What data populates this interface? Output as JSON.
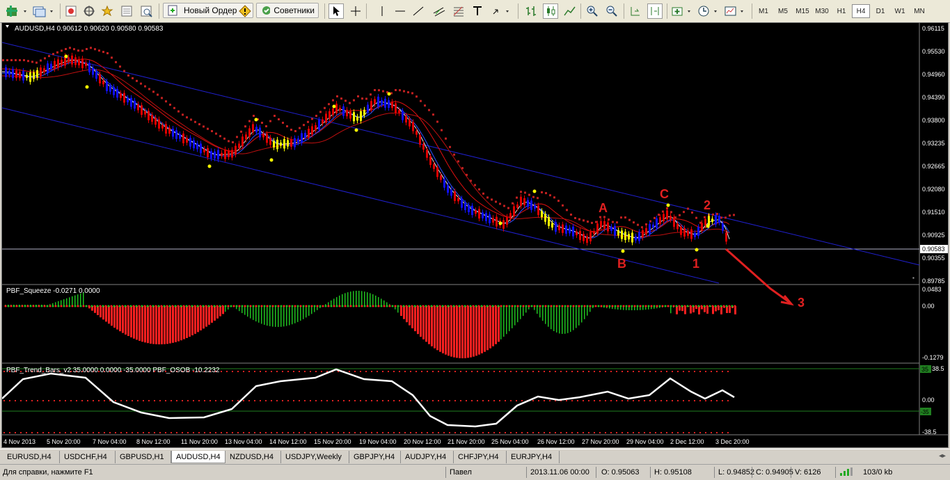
{
  "toolbar": {
    "new_order_label": "Новый Ордер",
    "advisors_label": "Советники",
    "timeframes": [
      "M1",
      "M5",
      "M15",
      "M30",
      "H1",
      "H4",
      "D1",
      "W1",
      "MN"
    ],
    "active_timeframe": "H4"
  },
  "chart": {
    "header": "AUDUSD,H4  0.90612 0.90620 0.90580 0.90583",
    "price_labels": [
      "0.96115",
      "0.95530",
      "0.94960",
      "0.94390",
      "0.93800",
      "0.93235",
      "0.92665",
      "0.92080",
      "0.91510",
      "0.90925",
      "0.90355",
      "0.89785"
    ],
    "current_price": "0.90583",
    "annotations": {
      "A": "A",
      "B": "B",
      "C": "C",
      "one": "1",
      "two": "2",
      "three": "3"
    },
    "date_labels": [
      "4 Nov 2013",
      "5 Nov 20:00",
      "7 Nov 04:00",
      "8 Nov 12:00",
      "11 Nov 20:00",
      "13 Nov 04:00",
      "14 Nov 12:00",
      "15 Nov 20:00",
      "19 Nov 04:00",
      "20 Nov 12:00",
      "21 Nov 20:00",
      "25 Nov 04:00",
      "26 Nov 12:00",
      "27 Nov 20:00",
      "29 Nov 04:00",
      "2 Dec 12:00",
      "3 Dec 20:00"
    ]
  },
  "squeeze": {
    "header": "PBF_Squeeze -0.0271 0.0000",
    "scale_labels": [
      "0.0483",
      "0.00",
      "-0.1279"
    ]
  },
  "trendbars": {
    "header": "PBF_Trend_Bars_v2 35.0000 0.0000 -35.0000  PBF_OSOB -10.2232",
    "scale_labels": [
      "38.5",
      "0.00",
      "-38.5"
    ],
    "level_tags": [
      "35",
      "-35"
    ]
  },
  "tabs": [
    "EURUSD,H4",
    "USDCHF,H4",
    "GBPUSD,H1",
    "AUDUSD,H4",
    "NZDUSD,H4",
    "USDJPY,Weekly",
    "GBPJPY,H4",
    "AUDJPY,H4",
    "CHFJPY,H4",
    "EURJPY,H4"
  ],
  "active_tab": "AUDUSD,H4",
  "status": {
    "help": "Для справки, нажмите F1",
    "profile": "Павел",
    "datetime": "2013.11.06 00:00",
    "open": "O: 0.95063",
    "high": "H: 0.95108",
    "low": "L: 0.94852",
    "close": "C: 0.94905",
    "volume": "V: 6126",
    "traffic": "103/0 kb"
  },
  "colors": {
    "bull": "#1010ff",
    "bear": "#e00000",
    "yellow": "#ffff00",
    "histo_red": "#ff2020",
    "histo_green": "#20c020",
    "osob": "#ffffff"
  }
}
